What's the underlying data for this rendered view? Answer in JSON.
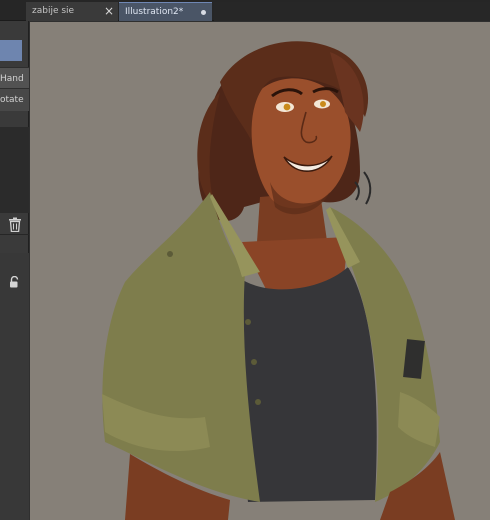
{
  "tabs": [
    {
      "label": "zabije sie",
      "active": false,
      "close_icon": "close-icon"
    },
    {
      "label": "Illustration2*",
      "active": true,
      "modified_icon": "unsaved-dot-icon"
    }
  ],
  "sidebar": {
    "tool_options": [
      {
        "label": "Hand"
      },
      {
        "label": "otate"
      }
    ],
    "icons": [
      "trash-icon",
      "lock-icon"
    ]
  },
  "canvas": {
    "background_color": "#868078",
    "artwork": "character-illustration"
  },
  "colors": {
    "tab_active": "#4a5566",
    "tool_highlight": "#6e85af",
    "panel": "#3a3a3a"
  }
}
